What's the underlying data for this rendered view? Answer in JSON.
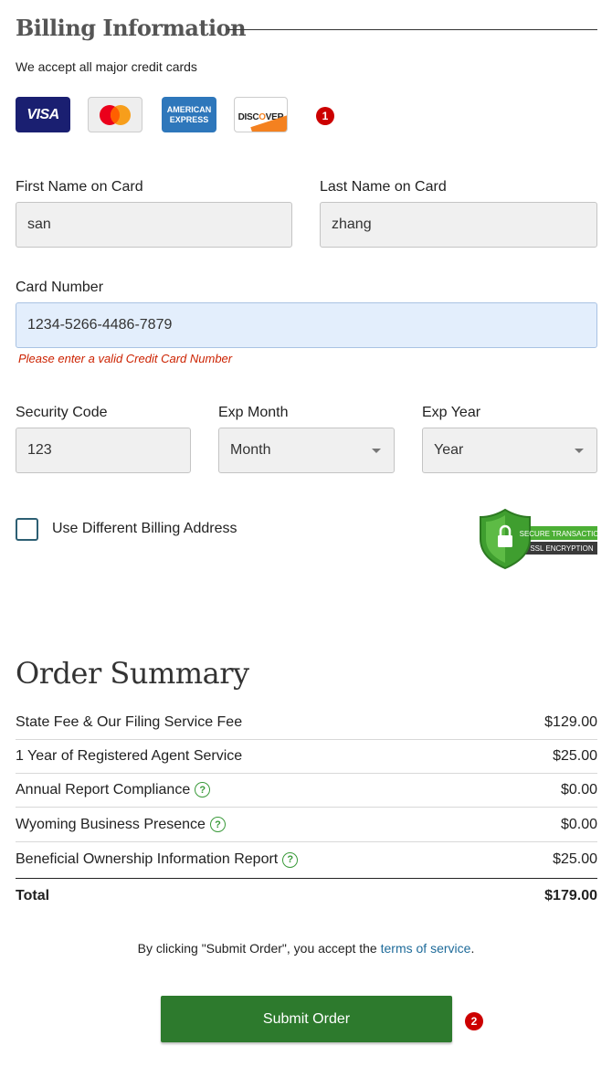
{
  "billing": {
    "title": "Billing Information",
    "accept_text": "We accept all major credit cards",
    "cards": {
      "visa": "VISA",
      "mastercard": "mastercard-logo",
      "amex_line1": "AMERICAN",
      "amex_line2": "EXPRESS",
      "discover_pre": "DISC",
      "discover_o": "O",
      "discover_post": "VER"
    },
    "step_badge": "1",
    "first_name": {
      "label": "First Name on Card",
      "value": "san"
    },
    "last_name": {
      "label": "Last Name on Card",
      "value": "zhang"
    },
    "card_number": {
      "label": "Card Number",
      "value": "1234-5266-4486-7879",
      "error": "Please enter a valid Credit Card Number"
    },
    "security_code": {
      "label": "Security Code",
      "value": "123"
    },
    "exp_month": {
      "label": "Exp Month",
      "selected": "Month"
    },
    "exp_year": {
      "label": "Exp Year",
      "selected": "Year"
    },
    "different_address": {
      "label": "Use Different Billing Address",
      "checked": false
    },
    "ssl": {
      "line1": "SECURE TRANSACTION",
      "line2": "SSL ENCRYPTION"
    }
  },
  "order": {
    "title": "Order Summary",
    "items": [
      {
        "name": "State Fee & Our Filing Service Fee",
        "price": "$129.00",
        "help": false
      },
      {
        "name": "1 Year of Registered Agent Service",
        "price": "$25.00",
        "help": false
      },
      {
        "name": "Annual Report Compliance",
        "price": "$0.00",
        "help": true
      },
      {
        "name": "Wyoming Business Presence",
        "price": "$0.00",
        "help": true
      },
      {
        "name": "Beneficial Ownership Information Report",
        "price": "$25.00",
        "help": true
      }
    ],
    "total_label": "Total",
    "total_value": "$179.00",
    "help_glyph": "?",
    "terms_prefix": "By clicking \"Submit Order\", you accept the ",
    "terms_link": "terms of service",
    "terms_suffix": ".",
    "submit_label": "Submit Order",
    "submit_badge": "2"
  },
  "colors": {
    "submit": "#2d7a2d",
    "error": "#cc2200",
    "badge": "#cc0000",
    "link": "#1e6b9a",
    "focus_field": "#e3eefc"
  }
}
